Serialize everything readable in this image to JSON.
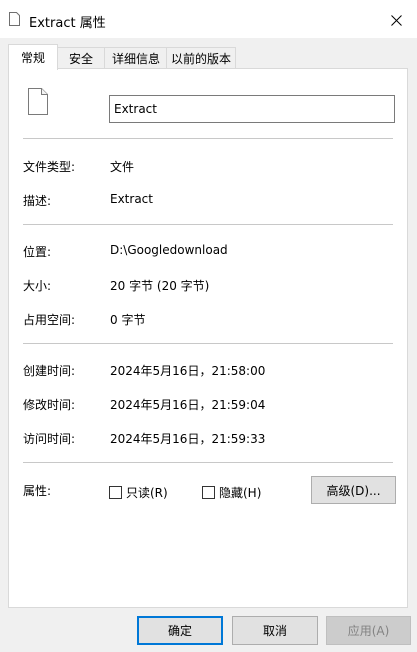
{
  "window": {
    "title": "Extract 属性",
    "close_icon": "close-icon"
  },
  "tabs": [
    {
      "label": "常规",
      "active": true
    },
    {
      "label": "安全",
      "active": false
    },
    {
      "label": "详细信息",
      "active": false
    },
    {
      "label": "以前的版本",
      "active": false
    }
  ],
  "general": {
    "file_name": "Extract",
    "file_type": {
      "label": "文件类型:",
      "value": "文件"
    },
    "description": {
      "label": "描述:",
      "value": "Extract"
    },
    "location": {
      "label": "位置:",
      "value": "D:\\Googledownload"
    },
    "size": {
      "label": "大小:",
      "value": "20 字节 (20 字节)"
    },
    "size_on_disk": {
      "label": "占用空间:",
      "value": "0 字节"
    },
    "created": {
      "label": "创建时间:",
      "value": "2024年5月16日，21:58:00"
    },
    "modified": {
      "label": "修改时间:",
      "value": "2024年5月16日，21:59:04"
    },
    "accessed": {
      "label": "访问时间:",
      "value": "2024年5月16日，21:59:33"
    },
    "attributes": {
      "label": "属性:",
      "readonly": {
        "label": "只读(R)",
        "checked": false
      },
      "hidden": {
        "label": "隐藏(H)",
        "checked": false
      },
      "advanced_button": "高级(D)..."
    }
  },
  "buttons": {
    "ok": "确定",
    "cancel": "取消",
    "apply": "应用(A)"
  },
  "colors": {
    "accent": "#0078d7",
    "window_bg": "#f0f0f0",
    "panel_bg": "#ffffff"
  }
}
